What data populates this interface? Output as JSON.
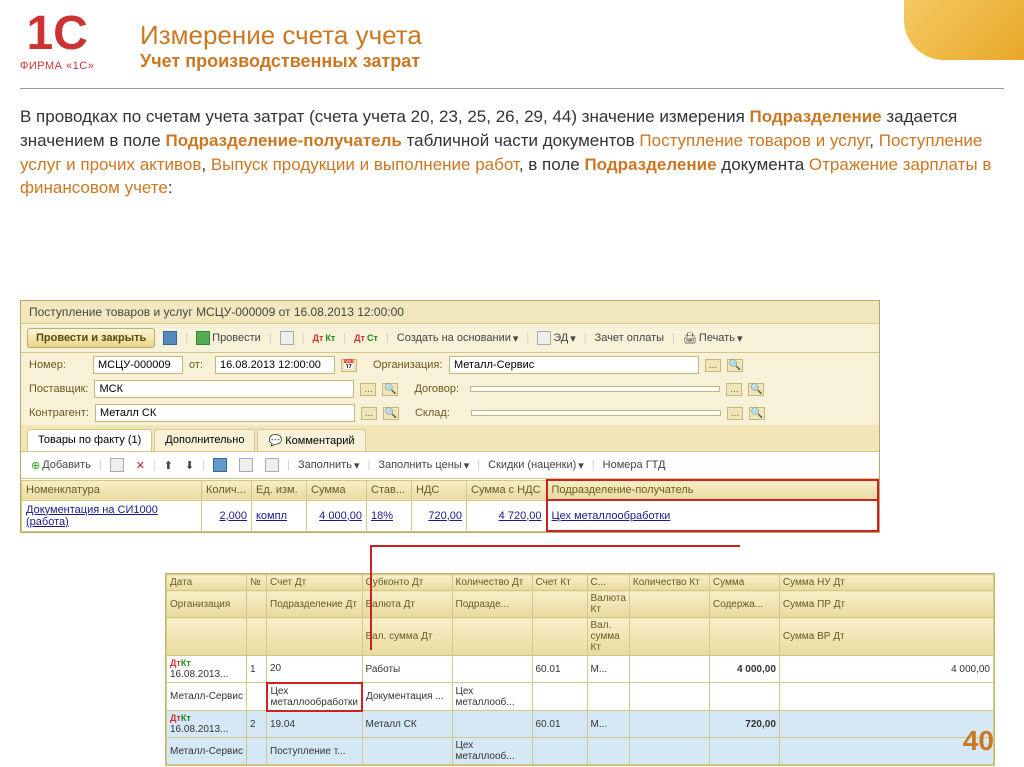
{
  "logo": {
    "mark": "1C",
    "sub": "ФИРМА «1С»"
  },
  "title": {
    "main": "Измерение счета учета",
    "sub": "Учет производственных затрат"
  },
  "content": {
    "p1a": "В проводках по счетам учета затрат (счета учета 20, 23, 25, 26, 29, 44) значение измерения ",
    "p1hb1": "Подразделение",
    "p1b": " задается значением в поле ",
    "p1hb2": "Подразделение-получатель",
    "p1c": " табличной части документов ",
    "p1h1": "Поступление товаров и услуг",
    "p1d": ", ",
    "p1h2": "Поступление услуг и прочих активов",
    "p1e": ", ",
    "p1h3": "Выпуск продукции и выполнение работ",
    "p1f": ", в поле ",
    "p1hb3": "Подразделение",
    "p1g": " документа ",
    "p1h4": "Отражение зарплаты в финансовом учете",
    "p1end": ":"
  },
  "app": {
    "title": "Поступление товаров и услуг МСЦУ-000009 от 16.08.2013 12:00:00",
    "toolbar": {
      "main_btn": "Провести и закрыть",
      "post": "Провести",
      "create_based": "Создать на основании",
      "ed": "ЭД",
      "offset": "Зачет оплаты",
      "print": "Печать"
    },
    "fields": {
      "num_lbl": "Номер:",
      "num_val": "МСЦУ-000009",
      "date_lbl": "от:",
      "date_val": "16.08.2013 12:00:00",
      "org_lbl": "Организация:",
      "org_val": "Металл-Сервис",
      "supplier_lbl": "Поставщик:",
      "supplier_val": "МСК",
      "contract_lbl": "Договор:",
      "contract_val": "",
      "counterparty_lbl": "Контрагент:",
      "counterparty_val": "Металл СК",
      "warehouse_lbl": "Склад:",
      "warehouse_val": ""
    },
    "tabs": {
      "t1": "Товары по факту (1)",
      "t2": "Дополнительно",
      "t3": "Комментарий"
    },
    "grid_toolbar": {
      "add": "Добавить",
      "fill": "Заполнить",
      "fill_prices": "Заполнить цены",
      "discounts": "Скидки (наценки)",
      "gtd": "Номера ГТД"
    },
    "grid": {
      "cols": [
        "Номенклатура",
        "Колич...",
        "Ед. изм.",
        "Сумма",
        "Став...",
        "НДС",
        "Сумма с НДС",
        "Подразделение-получатель"
      ],
      "row": [
        "Документация на СИ1000 (работа)",
        "2,000",
        "компл",
        "4 000,00",
        "18%",
        "720,00",
        "4 720,00",
        "Цех металлообработки"
      ]
    }
  },
  "ledger": {
    "head1": [
      "Дата",
      "№",
      "Счет Дт",
      "Субконто Дт",
      "Количество Дт",
      "Счет Кт",
      "С...",
      "Количество Кт",
      "Сумма",
      "Сумма НУ Дт"
    ],
    "head2": [
      "Организация",
      "",
      "Подразделение Дт",
      "Валюта Дт",
      "Подразде...",
      "",
      "Валюта Кт",
      "",
      "Содержа...",
      "Сумма ПР Дт"
    ],
    "head3": [
      "",
      "",
      "",
      "Вал. сумма Дт",
      "",
      "",
      "Вал. сумма Кт",
      "",
      "",
      "Сумма ВР Дт"
    ],
    "r1": [
      "16.08.2013...",
      "1",
      "20",
      "Работы",
      "",
      "60.01",
      "М...",
      "",
      "4 000,00",
      "4 000,00"
    ],
    "r1b": [
      "Металл-Сервис",
      "",
      "Цех металлообработки",
      "Документация ...",
      "Цех металлооб...",
      "",
      "",
      "",
      "",
      ""
    ],
    "r2": [
      "16.08.2013...",
      "2",
      "19.04",
      "Металл СК",
      "",
      "60.01",
      "М...",
      "",
      "720,00",
      ""
    ],
    "r2b": [
      "Металл-Сервис",
      "",
      "Поступление т...",
      "",
      "Цех металлооб...",
      "",
      "",
      "",
      "",
      ""
    ]
  },
  "page_num": "40"
}
